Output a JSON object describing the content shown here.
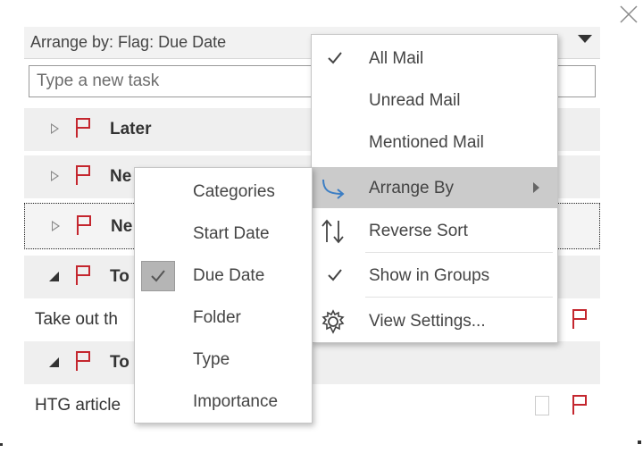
{
  "header": {
    "arrange_label": "Arrange by: Flag: Due Date"
  },
  "task_input": {
    "placeholder": "Type a new task"
  },
  "groups": [
    {
      "label": "Later"
    },
    {
      "label": "Ne"
    },
    {
      "label": "Ne"
    },
    {
      "label": "To"
    },
    {
      "label": "To"
    }
  ],
  "tasks": [
    {
      "title": "Take out th"
    },
    {
      "title": "HTG article"
    }
  ],
  "main_menu": {
    "items": [
      {
        "label": "All Mail",
        "checked": true
      },
      {
        "label": "Unread Mail"
      },
      {
        "label": "Mentioned Mail"
      },
      {
        "label": "Arrange By",
        "icon": "arrange-by-icon",
        "has_submenu": true,
        "highlighted": true
      },
      {
        "label": "Reverse Sort",
        "icon": "reverse-sort-icon"
      },
      {
        "label": "Show in Groups",
        "checked": true
      },
      {
        "label": "View Settings...",
        "icon": "gear-icon"
      }
    ]
  },
  "sub_menu": {
    "items": [
      {
        "label": "Categories"
      },
      {
        "label": "Start Date"
      },
      {
        "label": "Due Date",
        "checked": true
      },
      {
        "label": "Folder"
      },
      {
        "label": "Type"
      },
      {
        "label": "Importance"
      }
    ]
  },
  "colors": {
    "flag": "#c4262e",
    "highlight": "#cbcbcb",
    "arrange_icon": "#3c7ec4"
  }
}
